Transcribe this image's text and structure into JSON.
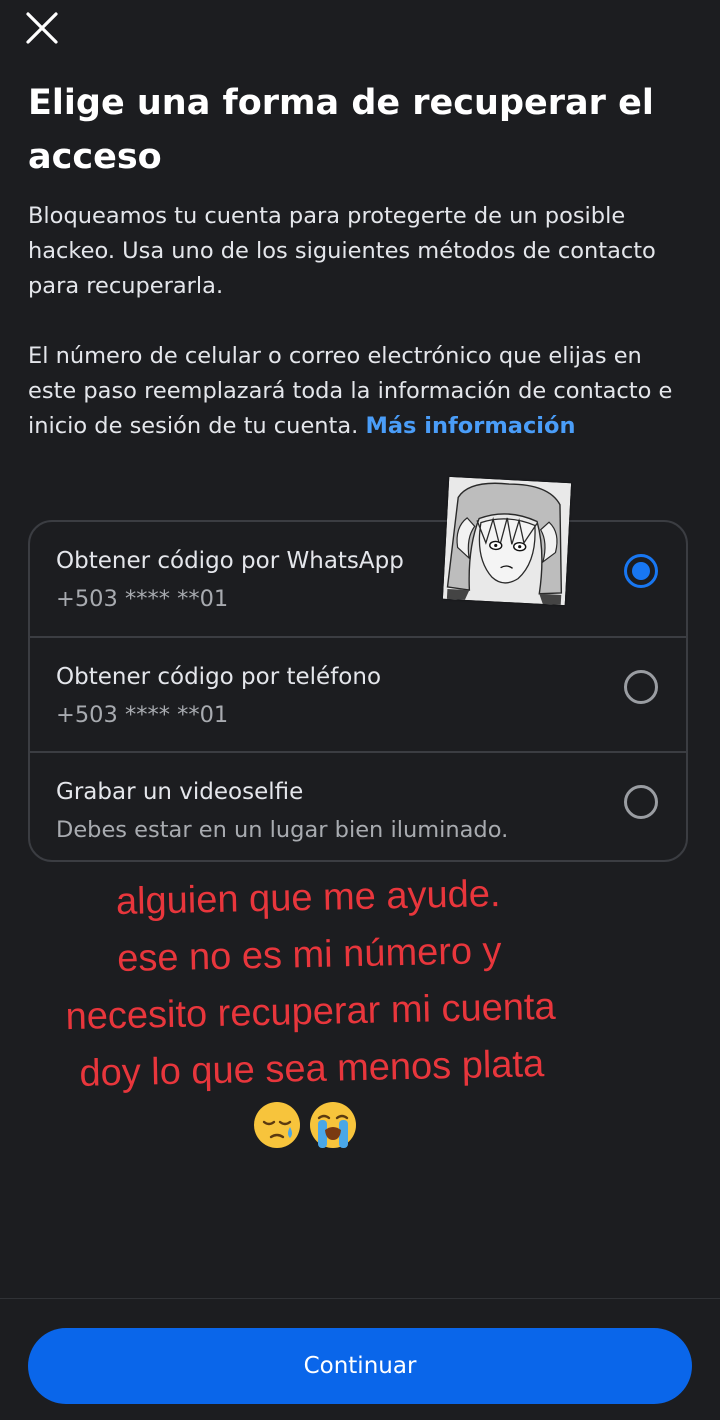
{
  "header": {
    "close_icon": "close-icon",
    "title": "Elige una forma de recuperar el acceso"
  },
  "intro": {
    "paragraph1": "Bloqueamos tu cuenta para protegerte de un posible hackeo. Usa uno de los siguientes métodos de contacto para recuperarla.",
    "paragraph2": "El número de celular o correo electrónico que elijas en este paso reemplazará toda la información de contacto e inicio de sesión de tu cuenta.",
    "more_link": "Más información"
  },
  "options": [
    {
      "label": "Obtener código por WhatsApp",
      "sub": "+503 **** **01",
      "selected": true
    },
    {
      "label": "Obtener código por teléfono",
      "sub": "+503 **** **01",
      "selected": false
    },
    {
      "label": "Grabar un videoselfie",
      "sub": "Debes estar en un lugar bien iluminado.",
      "selected": false
    }
  ],
  "overlay": {
    "lines": [
      "alguien que me ayude.",
      "ese no es mi número y",
      "necesito recuperar mi cuenta",
      "doy lo que sea menos plata"
    ],
    "emojis": [
      "sleepy-face-emoji",
      "loudly-crying-face-emoji"
    ],
    "color": "#e8363c"
  },
  "sticker": {
    "description_icon": "anime-girl-sticker"
  },
  "footer": {
    "continue_label": "Continuar"
  },
  "colors": {
    "background": "#1c1d20",
    "accent": "#1877f2",
    "button": "#0a66ea",
    "link": "#4a9df8"
  }
}
